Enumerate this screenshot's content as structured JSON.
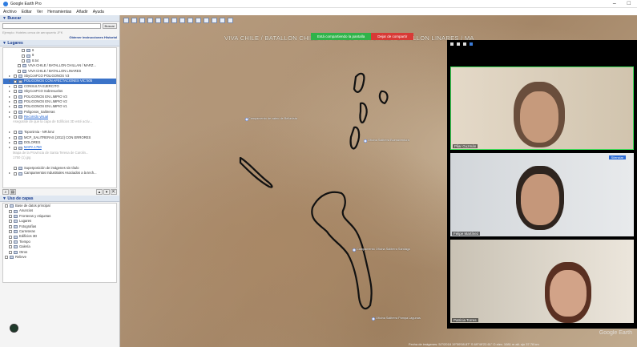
{
  "window": {
    "title": "Google Earth Pro",
    "minimize": "–",
    "maximize": "□"
  },
  "menu": [
    "Archivo",
    "Editar",
    "Ver",
    "Herramientas",
    "Añadir",
    "Ayuda"
  ],
  "search": {
    "header": "▼ Buscar",
    "placeholder": "",
    "button": "Buscar",
    "hint": "Ejemplo: Hoteles cerca de aeropuerto JFK",
    "links": "Obtener instrucciones  Historial"
  },
  "places": {
    "header": "▼ Lugares",
    "items": [
      {
        "label": "6",
        "indent": 3,
        "icon": "file"
      },
      {
        "label": "8",
        "indent": 3,
        "icon": "file"
      },
      {
        "label": "8.54",
        "indent": 3,
        "icon": "file"
      },
      {
        "label": "VIVA CHILE / BATALLON CHILLAN / MARZ...",
        "indent": 2,
        "icon": "pin"
      },
      {
        "label": "VIVA CHILE / BATALLON LINARES",
        "indent": 2,
        "icon": "pin"
      },
      {
        "label": "SbyConFCO POLIGONOS V3",
        "indent": 1,
        "icon": "folder"
      },
      {
        "label": "POLIGONOS CON AFECTACIONES VIC'S05",
        "indent": 1,
        "icon": "folder",
        "selected": true
      },
      {
        "label": "CONSULTA EJERCITO",
        "indent": 1,
        "icon": "folder"
      },
      {
        "label": "SbyConFCO Sobrevuelos",
        "indent": 1,
        "icon": "folder"
      },
      {
        "label": "POLIGONOS EN LIMPIO V3",
        "indent": 1,
        "icon": "folder"
      },
      {
        "label": "POLIGONOS EN LIMPIO V2",
        "indent": 1,
        "icon": "folder"
      },
      {
        "label": "POLIGONOS EN LIMPIO V1",
        "indent": 1,
        "icon": "folder"
      },
      {
        "label": "Poligonos_Salitreras",
        "indent": 1,
        "icon": "folder"
      },
      {
        "label": "Recorrido visual",
        "indent": 1,
        "icon": "folder",
        "link": true
      },
      {
        "label": "Asegúrate de que la capa de Edificios 3D esté activ...",
        "indent": 2,
        "icon": "none",
        "sub": true
      },
      {
        "label": "",
        "indent": 1,
        "icon": "none"
      },
      {
        "label": "Toponimia - NR.kmz",
        "indent": 1,
        "icon": "folder"
      },
      {
        "label": "MCP_SALITRERAS (2012) CON ERRORES",
        "indent": 1,
        "icon": "folder"
      },
      {
        "label": "DOLORES",
        "indent": 1,
        "icon": "folder"
      },
      {
        "label": "MAPA 1750",
        "indent": 1,
        "icon": "folder",
        "link": true
      },
      {
        "label": "Mapa de la Provincia de Santa Teresa de Carolin...",
        "indent": 2,
        "icon": "none",
        "sub": true
      },
      {
        "label": "1750 (1).jpg",
        "indent": 2,
        "icon": "none",
        "sub": true
      },
      {
        "label": "",
        "indent": 1,
        "icon": "none"
      },
      {
        "label": "Superposición de imágenes sin título",
        "indent": 1,
        "icon": "file"
      },
      {
        "label": "Campamentos Industriales Asociados a la tech...",
        "indent": 1,
        "icon": "folder"
      }
    ]
  },
  "layers": {
    "header": "▼ Uso de capas",
    "items": [
      {
        "label": "Base de datos principal",
        "indent": 0
      },
      {
        "label": "Anuncios",
        "indent": 1
      },
      {
        "label": "Fronteras y etiquetas",
        "indent": 1
      },
      {
        "label": "Lugares",
        "indent": 1
      },
      {
        "label": "Fotografías",
        "indent": 1
      },
      {
        "label": "Carreteras",
        "indent": 1
      },
      {
        "label": "Edificios 3D",
        "indent": 1
      },
      {
        "label": "Tiempo",
        "indent": 1
      },
      {
        "label": "Galería",
        "indent": 1
      },
      {
        "label": "Otros",
        "indent": 1
      },
      {
        "label": "Relieve",
        "indent": 0
      }
    ]
  },
  "map": {
    "banner": "VIVA CHILE / BATALLON CHILLAN / MARZO   VIVA CHILE / BATALLON LINARES / MA",
    "share_status": "Está compartiendo la pantalla",
    "share_stop": "Dejar de compartir",
    "place_labels": [
      "Campamento de cateo de Bellavista",
      "Oficina Salitrera Buenaventura",
      "Campamento Oficina Salitrera Santiago",
      "Oficina Salitrera Pampa Lagunas"
    ],
    "status_text": "Fecha de imágenes: 5/7/2018   19°59'08.87\" S 69°49'22.61\" O  elev. 1081 m  alt. ojo 37.78 km",
    "credit": "Google Earth"
  },
  "video": {
    "participants": [
      {
        "name": "Pilar Guzmán"
      },
      {
        "name": "Felipe Martínez",
        "chip": "Silenciar"
      },
      {
        "name": "Patricia Torres"
      }
    ]
  }
}
